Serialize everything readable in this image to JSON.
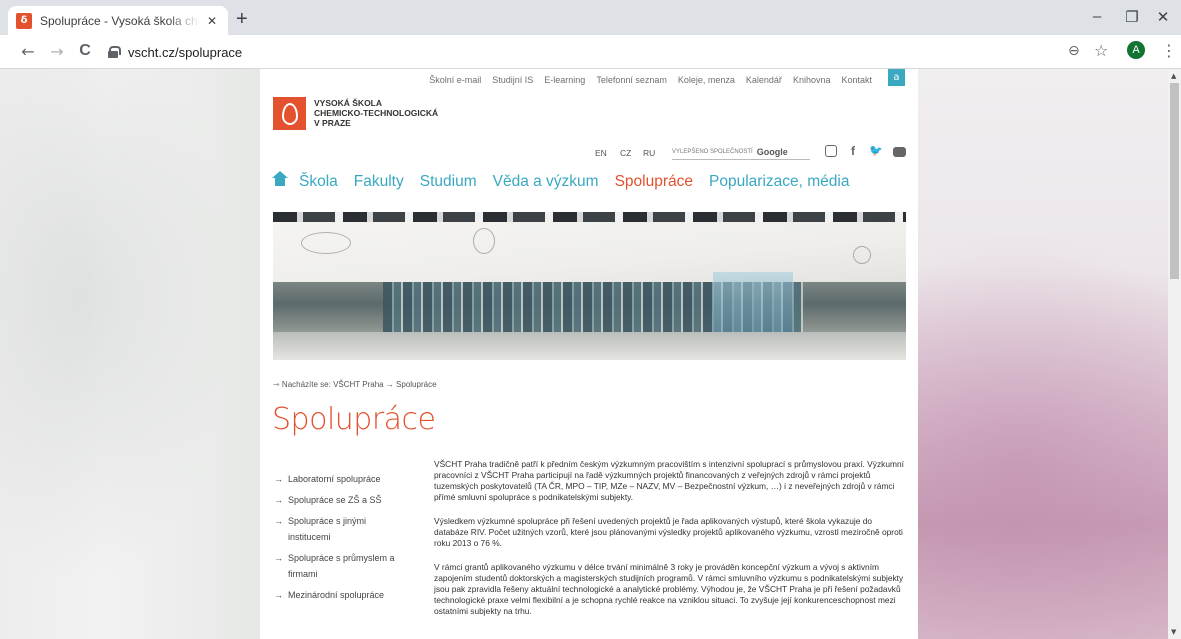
{
  "browser": {
    "tab_title": "Spolupráce - Vysoká škola chemicko-technologická v Praze",
    "favicon_glyph": "δ",
    "url": "vscht.cz/spoluprace",
    "new_tab_glyph": "+",
    "close_glyph": "✕",
    "profile_initial": "A",
    "minimize_glyph": "–",
    "restore_glyph": "❐",
    "window_close_glyph": "✕",
    "back_glyph": "←",
    "forward_glyph": "→",
    "reload_glyph": "C",
    "zoom_glyph": "⊖",
    "star_glyph": "☆",
    "menu_glyph": "⋮"
  },
  "header": {
    "utility_links": [
      "Školní e-mail",
      "Studijní IS",
      "E-learning",
      "Telefonní seznam",
      "Koleje, menza",
      "Kalendář",
      "Knihovna",
      "Kontakt"
    ],
    "access_glyph": "a",
    "logo_line1": "VYSOKÁ ŠKOLA",
    "logo_line2": "CHEMICKO-TECHNOLOGICKÁ",
    "logo_line3": "V PRAZE",
    "languages": [
      "EN",
      "CZ",
      "RU"
    ],
    "search_label": "VYLEPŠENO SPOLEČNOSTÍ",
    "search_brand": "Google",
    "social_f": "f",
    "social_twitter": "🐦"
  },
  "nav": {
    "items": [
      {
        "label": "Škola",
        "active": false
      },
      {
        "label": "Fakulty",
        "active": false
      },
      {
        "label": "Studium",
        "active": false
      },
      {
        "label": "Věda a výzkum",
        "active": false
      },
      {
        "label": "Spolupráce",
        "active": true
      },
      {
        "label": "Popularizace, média",
        "active": false
      }
    ]
  },
  "breadcrumb": {
    "text": "⇾ Nacházíte se: VŠCHT Praha → Spolupráce"
  },
  "page": {
    "title": "Spolupráce"
  },
  "sidebar": {
    "arrow": "→",
    "items": [
      "Laboratorní spolupráce",
      "Spolupráce se ZŠ a SŠ",
      "Spolupráce s jinými institucemi",
      "Spolupráce s průmyslem a firmami",
      "Mezinárodní spolupráce"
    ]
  },
  "content": {
    "paragraphs": [
      "VŠCHT Praha tradičně patří k předním českým výzkumným pracovištím s intenzivní spoluprací s průmyslovou praxí. Výzkumní pracovníci z VŠCHT Praha participují na řadě výzkumných projektů financovaných z veřejných zdrojů v rámci projektů tuzemských poskytovatelů (TA ČR, MPO – TIP, MZe – NAZV, MV – Bezpečnostní výzkum, …) i z neveřejných zdrojů v rámci přímé smluvní spolupráce s podnikatelskými subjekty.",
      "Výsledkem výzkumné spolupráce při řešení uvedených projektů je řada aplikovaných výstupů, které škola vykazuje do databáze RIV. Počet užitných vzorů, které jsou plánovanými výsledky projektů aplikovaného výzkumu, vzrostl meziročně oproti roku 2013 o 76 %.",
      "V rámci grantů aplikovaného výzkumu v délce trvání minimálně 3 roky je prováděn koncepční výzkum a vývoj s aktivním zapojením studentů doktorských a magisterských studijních programů. V rámci smluvního výzkumu s podnikatelskými subjekty jsou pak zpravidla řešeny aktuální technologické a analytické problémy. Výhodou je, že VŠCHT Praha je při řešení požadavků technologické praxe velmi flexibilní a je schopna rychlé reakce na vzniklou situaci. To zvyšuje její konkurenceschopnost mezi ostatními subjekty na trhu."
    ]
  },
  "colors": {
    "brand_red": "#e3512e",
    "nav_teal": "#3aa8c1"
  }
}
